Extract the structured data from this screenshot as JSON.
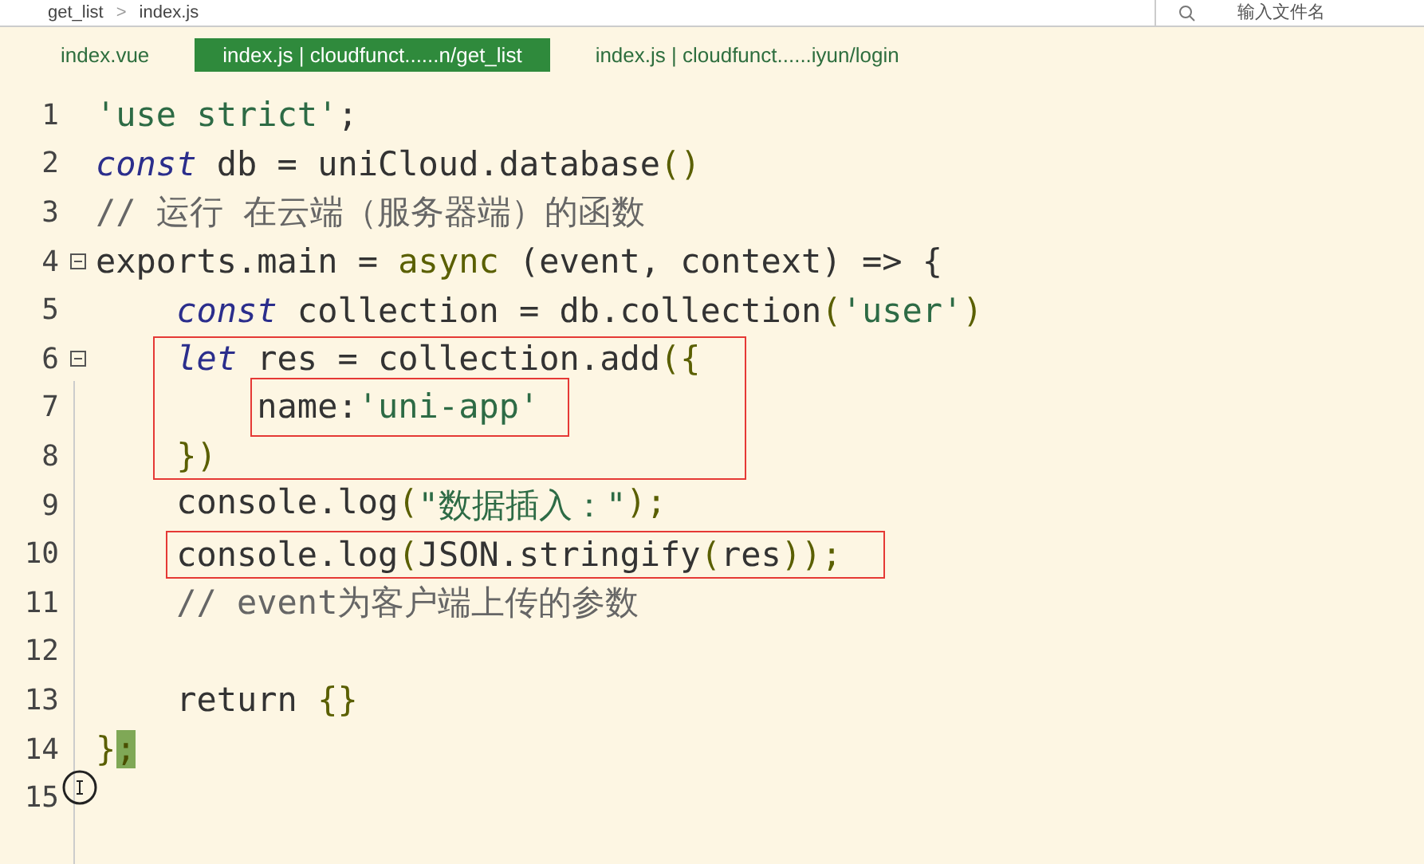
{
  "top_bar": {
    "breadcrumb": [
      "get_list",
      "index.js"
    ],
    "breadcrumb_separator": ">",
    "search": {
      "placeholder": "输入文件名"
    }
  },
  "tabs": [
    {
      "label": "index.vue",
      "selected": false
    },
    {
      "label": "index.js | cloudfunct......n/get_list",
      "selected": true
    },
    {
      "label": "index.js | cloudfunct......iyun/login",
      "selected": false
    }
  ],
  "editor": {
    "lines": [
      {
        "number": "1",
        "foldable": false,
        "tokens": [
          {
            "kind": "string",
            "text": "'use strict'"
          },
          {
            "kind": "plain",
            "text": ";"
          }
        ]
      },
      {
        "number": "2",
        "foldable": false,
        "tokens": [
          {
            "kind": "keyword",
            "text": "const"
          },
          {
            "kind": "plain",
            "text": " db = uniCloud.database"
          },
          {
            "kind": "punct",
            "text": "()"
          }
        ]
      },
      {
        "number": "3",
        "foldable": false,
        "tokens": [
          {
            "kind": "comment",
            "text": "// 运行 在云端（服务器端）的函数"
          }
        ]
      },
      {
        "number": "4",
        "foldable": true,
        "tokens": [
          {
            "kind": "plain",
            "text": "exports.main = "
          },
          {
            "kind": "builtin",
            "text": "async"
          },
          {
            "kind": "plain",
            "text": " (event, context) => {"
          }
        ],
        "children": [
          {
            "number": "5",
            "foldable": false,
            "tokens": [
              {
                "kind": "keyword",
                "text": "const"
              },
              {
                "kind": "plain",
                "text": " collection = db.collection"
              },
              {
                "kind": "punct",
                "text": "("
              },
              {
                "kind": "string",
                "text": "'user'"
              },
              {
                "kind": "punct",
                "text": ")"
              }
            ]
          },
          {
            "number": "6",
            "foldable": true,
            "tokens": [
              {
                "kind": "keyword",
                "text": "let"
              },
              {
                "kind": "plain",
                "text": " res = collection.add"
              },
              {
                "kind": "punct",
                "text": "({"
              }
            ],
            "children": [
              {
                "number": "7",
                "foldable": false,
                "boxed": true,
                "tokens": [
                  {
                    "kind": "plain",
                    "text": "name:"
                  },
                  {
                    "kind": "string",
                    "text": "'uni-app'"
                  }
                ]
              }
            ]
          },
          {
            "number": "8",
            "foldable": false,
            "tokens": [
              {
                "kind": "punct",
                "text": "})"
              }
            ]
          },
          {
            "number": "9",
            "foldable": false,
            "tokens": [
              {
                "kind": "plain",
                "text": "console.log"
              },
              {
                "kind": "punct",
                "text": "("
              },
              {
                "kind": "string",
                "text": "\"数据插入：\""
              },
              {
                "kind": "punct",
                "text": ");"
              }
            ]
          },
          {
            "number": "10",
            "foldable": false,
            "boxed": true,
            "tokens": [
              {
                "kind": "plain",
                "text": "console.log"
              },
              {
                "kind": "punct",
                "text": "("
              },
              {
                "kind": "plain",
                "text": "JSON.stringify"
              },
              {
                "kind": "punct",
                "text": "("
              },
              {
                "kind": "plain",
                "text": "res"
              },
              {
                "kind": "punct",
                "text": "));"
              }
            ]
          },
          {
            "number": "11",
            "foldable": false,
            "tokens": [
              {
                "kind": "comment",
                "text": "// event为客户端上传的参数"
              }
            ]
          },
          {
            "number": "12",
            "foldable": false
          },
          {
            "number": "13",
            "foldable": false,
            "tokens": [
              {
                "kind": "plain",
                "text": "return "
              },
              {
                "kind": "punct",
                "text": "{}"
              }
            ]
          }
        ]
      },
      {
        "number": "14",
        "foldable": false,
        "tokens": [
          {
            "kind": "punct",
            "text": "}"
          },
          {
            "kind": "match",
            "text": ";"
          }
        ]
      },
      {
        "number": "15",
        "foldable": false
      }
    ]
  }
}
